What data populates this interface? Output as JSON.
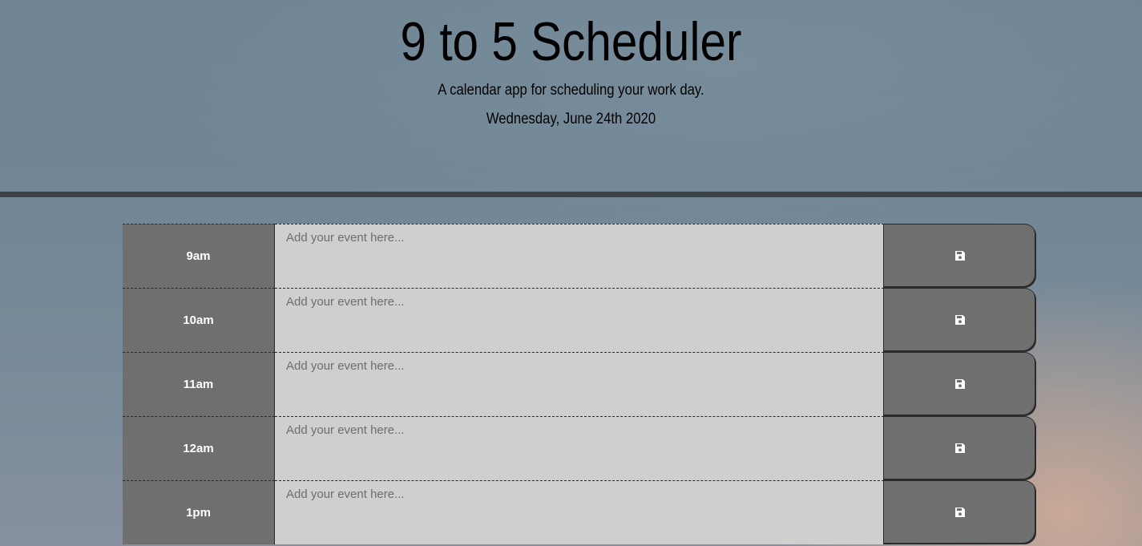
{
  "header": {
    "title": "9 to 5 Scheduler",
    "subtitle": "A calendar app for scheduling your work day.",
    "current_day": "Wednesday, June 24th 2020"
  },
  "colors": {
    "hour_bg": "#6f6f6f",
    "textarea_bg": "#cfcfcf",
    "divider": "#3d4247"
  },
  "time_blocks": [
    {
      "hour": "9am",
      "placeholder": "Add your event here...",
      "value": "",
      "save_icon": "save-icon"
    },
    {
      "hour": "10am",
      "placeholder": "Add your event here...",
      "value": "",
      "save_icon": "save-icon"
    },
    {
      "hour": "11am",
      "placeholder": "Add your event here...",
      "value": "",
      "save_icon": "save-icon"
    },
    {
      "hour": "12am",
      "placeholder": "Add your event here...",
      "value": "",
      "save_icon": "save-icon"
    },
    {
      "hour": "1pm",
      "placeholder": "Add your event here...",
      "value": "",
      "save_icon": "save-icon"
    }
  ]
}
